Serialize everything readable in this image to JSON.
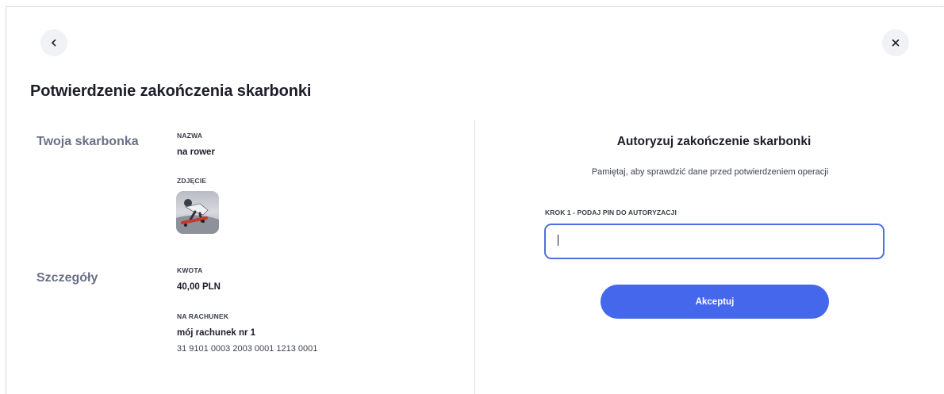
{
  "header": {
    "back_icon": "chevron-left-icon",
    "close_icon": "close-icon",
    "title": "Potwierdzenie zakończenia skarbonki"
  },
  "piggybank": {
    "section_label": "Twoja skarbonka",
    "name_label": "NAZWA",
    "name_value": "na rower",
    "photo_label": "ZDJĘCIE"
  },
  "details": {
    "section_label": "Szczegóły",
    "amount_label": "KWOTA",
    "amount_value": "40,00 PLN",
    "account_label": "NA RACHUNEK",
    "account_name": "mój rachunek nr 1",
    "account_number": "31 9101 0003 2003 0001 1213 0001"
  },
  "auth": {
    "title": "Autoryzuj zakończenie skarbonki",
    "hint": "Pamiętaj, aby sprawdzić dane przed potwierdzeniem operacji",
    "pin_label": "KROK 1 - PODAJ PIN DO AUTORYZACJI",
    "pin_value": "",
    "accept_label": "Akceptuj"
  },
  "colors": {
    "accent": "#4467ec",
    "input_border": "#4f6fe0",
    "section_label": "#6a7086"
  }
}
